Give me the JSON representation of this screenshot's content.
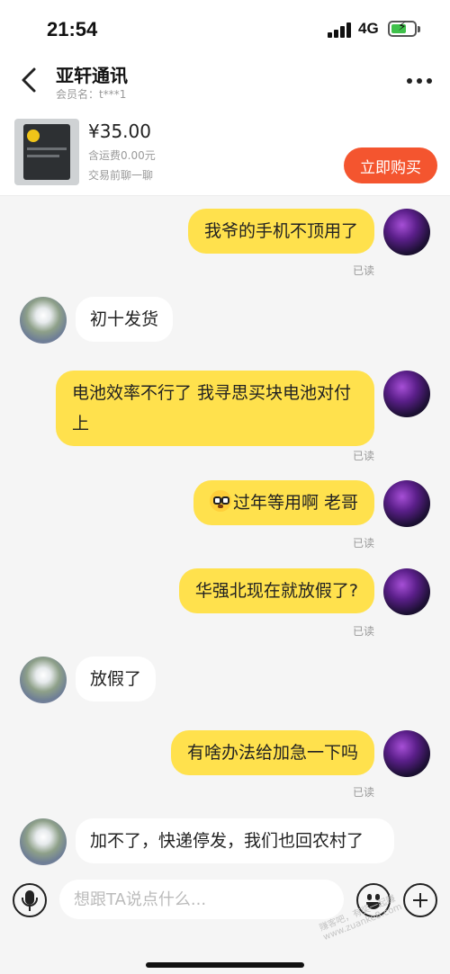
{
  "status_bar": {
    "time": "21:54",
    "network": "4G",
    "battery": "charging"
  },
  "header": {
    "shop_name": "亚轩通讯",
    "member_label": "会员名：t***1"
  },
  "product": {
    "price": "¥35.00",
    "shipping": "含运费0.00元",
    "chat_prompt": "交易前聊一聊",
    "buy_label": "立即购买"
  },
  "messages": [
    {
      "side": "self",
      "text": "我爷的手机不顶用了",
      "status": "已读"
    },
    {
      "side": "other",
      "text": "初十发货"
    },
    {
      "side": "self",
      "text": "电池效率不行了 我寻思买块电池对付上",
      "status": "已读"
    },
    {
      "side": "self",
      "text": "过年等用啊 老哥",
      "emoji": "flushed-face",
      "status": "已读"
    },
    {
      "side": "self",
      "text": "华强北现在就放假了?",
      "status": "已读"
    },
    {
      "side": "other",
      "text": "放假了"
    },
    {
      "side": "self",
      "text": "有啥办法给加急一下吗",
      "status": "已读"
    },
    {
      "side": "other",
      "text": "加不了，快递停发，我们也回农村了"
    }
  ],
  "input_bar": {
    "placeholder": "想跟TA说点什么..."
  },
  "watermark": "赚客吧，有奖一起赚 www.zuanke8.com",
  "colors": {
    "self_bubble": "#ffe14d",
    "buy_button": "#f4552f",
    "background": "#f5f5f5"
  }
}
